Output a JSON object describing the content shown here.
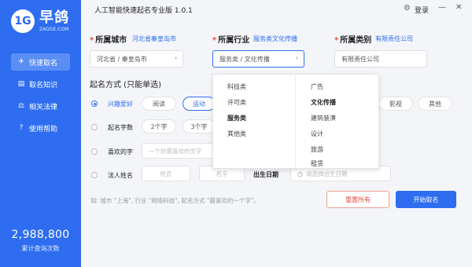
{
  "app": {
    "title": "人工智能快速起名专业版 1.0.1",
    "logo_mark": "1G",
    "logo_name": "早鸽",
    "logo_sub": "ZAOGE.COM",
    "login_label": "登录",
    "accent_color": "#2e6df0"
  },
  "sidebar": {
    "items": [
      {
        "label": "快速取名",
        "icon": "rocket-icon",
        "glyph": "✈"
      },
      {
        "label": "取名知识",
        "icon": "book-icon",
        "glyph": "▤"
      },
      {
        "label": "相关法律",
        "icon": "scale-icon",
        "glyph": "⚖"
      },
      {
        "label": "使用帮助",
        "icon": "help-icon",
        "glyph": "?"
      }
    ],
    "counter_value": "2,988,800",
    "counter_label": "累计查询次数"
  },
  "form": {
    "city": {
      "label": "所属城市",
      "hint": "河北省秦皇岛市",
      "value": "河北省 / 秦皇岛市"
    },
    "industry": {
      "label": "所属行业",
      "hint": "服务类文化传播",
      "value": "服务类 / 文化传播"
    },
    "category": {
      "label": "所属类别",
      "hint": "有限责任公司",
      "value": "有限责任公司"
    },
    "method_title": "起名方式 (只能单选)",
    "hobby": {
      "label": "兴趣爱好",
      "options": [
        "阅读",
        "运动",
        "影视",
        "其他"
      ]
    },
    "char_count": {
      "label": "起名字数",
      "options": [
        "2个字",
        "3个字"
      ]
    },
    "favorite_char": {
      "label": "喜欢的字",
      "placeholder": "一个你最喜欢的文字"
    },
    "legal_person": {
      "label": "法人姓名",
      "surname_placeholder": "姓氏",
      "name_placeholder": "名字",
      "birth_label": "出生日期",
      "birth_placeholder": "请选择出生日期"
    },
    "example": "如: 城市 \"上海\", 行业 \"网络科技\", 起名方式 \"最喜欢的一个字\"。",
    "reset_label": "重置所有",
    "start_label": "开始取名"
  },
  "dropdown": {
    "left": [
      "科技类",
      "许可类",
      "服务类",
      "其他类"
    ],
    "right": [
      "广告",
      "文化传播",
      "建筑装潢",
      "设计",
      "旅游",
      "租赁"
    ]
  }
}
